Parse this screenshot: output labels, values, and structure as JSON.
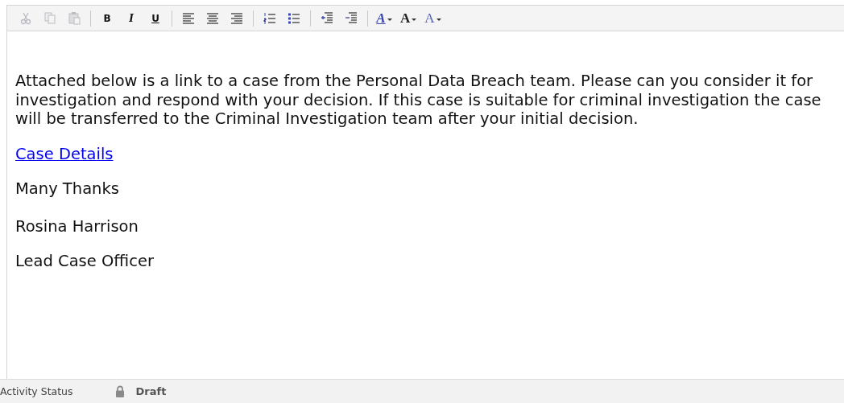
{
  "toolbar": {
    "groups": [
      [
        {
          "kind": "cut",
          "disabled": true
        },
        {
          "kind": "copy",
          "disabled": true
        },
        {
          "kind": "paste",
          "disabled": true
        }
      ],
      [
        {
          "kind": "bold",
          "label": "B",
          "disabled": false
        },
        {
          "kind": "italic",
          "label": "I",
          "disabled": false
        },
        {
          "kind": "underline",
          "label": "U",
          "disabled": false
        }
      ],
      [
        {
          "kind": "align-left",
          "disabled": false
        },
        {
          "kind": "align-center",
          "disabled": false
        },
        {
          "kind": "align-right",
          "disabled": false
        }
      ],
      [
        {
          "kind": "numbered-list",
          "disabled": false
        },
        {
          "kind": "bullet-list",
          "disabled": false
        }
      ],
      [
        {
          "kind": "outdent",
          "disabled": false
        },
        {
          "kind": "indent",
          "disabled": false
        }
      ],
      [
        {
          "kind": "highlight",
          "label": "A",
          "disabled": false
        },
        {
          "kind": "font-size",
          "label": "A",
          "disabled": false
        },
        {
          "kind": "font-color",
          "label": "A",
          "disabled": false
        }
      ]
    ]
  },
  "body": [
    {
      "kind": "paragraph",
      "text": "Attached below is a link to a case from the Personal Data Breach team.  Please can you consider it for investigation and respond with your decision. If this case is suitable for criminal investigation the case will be transferred to the Criminal Investigation team after your initial decision."
    },
    {
      "kind": "link",
      "text": "Case Details"
    },
    {
      "kind": "paragraph",
      "text": "Many Thanks"
    },
    {
      "kind": "blank"
    },
    {
      "kind": "paragraph",
      "text": "Rosina Harrison"
    },
    {
      "kind": "paragraph",
      "text": "Lead Case Officer"
    }
  ],
  "status_bar": {
    "label": "Activity Status",
    "status": "Draft",
    "locked": true
  }
}
